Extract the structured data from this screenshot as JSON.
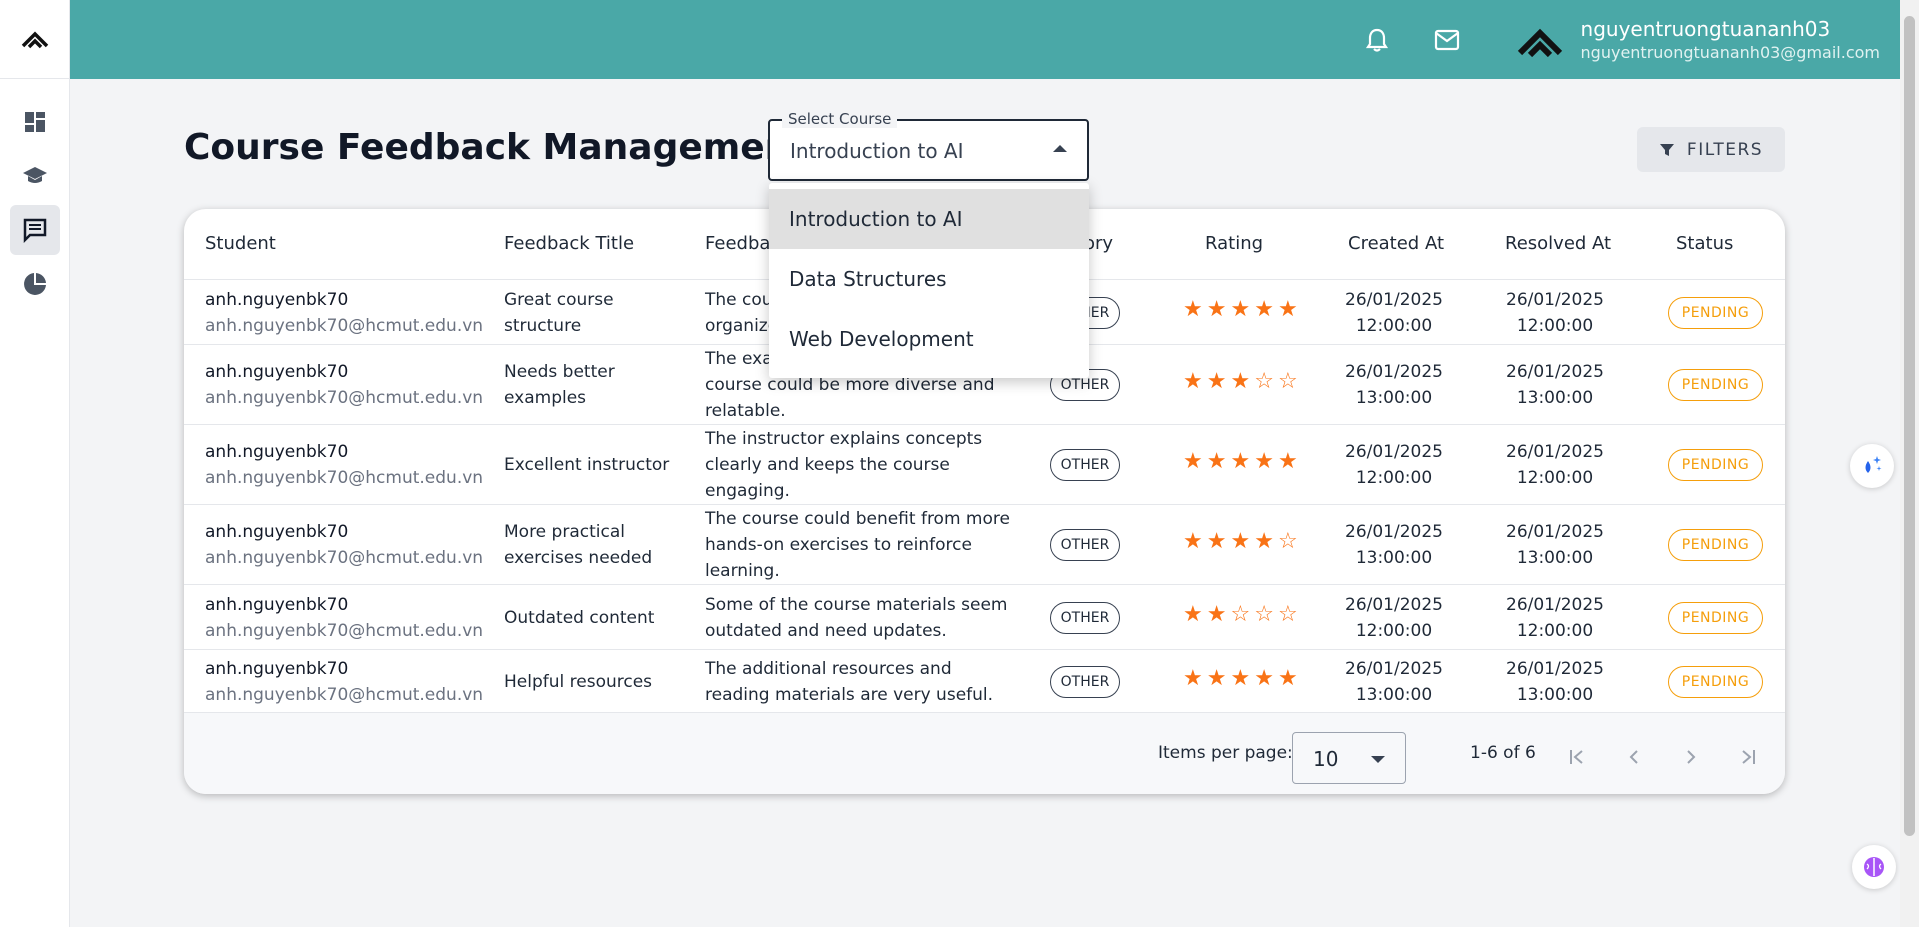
{
  "topbar": {
    "user_name": "nguyentruongtuananh03",
    "user_email": "nguyentruongtuananh03@gmail.com"
  },
  "page": {
    "title": "Course Feedback Management",
    "select_label": "Select Course",
    "selected_course": "Introduction to AI",
    "filters_label": "FILTERS"
  },
  "dropdown": {
    "options": [
      "Introduction to AI",
      "Data Structures",
      "Web Development"
    ]
  },
  "table": {
    "headers": {
      "student": "Student",
      "title": "Feedback Title",
      "content": "Feedback",
      "category": "ory",
      "rating": "Rating",
      "created": "Created At",
      "resolved": "Resolved At",
      "status": "Status"
    },
    "rows": [
      {
        "name": "anh.nguyenbk70",
        "email": "anh.nguyenbk70@hcmut.edu.vn",
        "title1": "Great course",
        "title2": "structure",
        "c1": "The course",
        "c2": "organized",
        "c3": "",
        "category": "OTHER",
        "rating": 5,
        "cd": "26/01/2025",
        "ct": "12:00:00",
        "rd": "26/01/2025",
        "rt": "12:00:00",
        "status": "PENDING"
      },
      {
        "name": "anh.nguyenbk70",
        "email": "anh.nguyenbk70@hcmut.edu.vn",
        "title1": "Needs better",
        "title2": "examples",
        "c1": "The examples",
        "c2": "course could be more diverse and",
        "c3": "relatable.",
        "category": "OTHER",
        "rating": 3,
        "cd": "26/01/2025",
        "ct": "13:00:00",
        "rd": "26/01/2025",
        "rt": "13:00:00",
        "status": "PENDING"
      },
      {
        "name": "anh.nguyenbk70",
        "email": "anh.nguyenbk70@hcmut.edu.vn",
        "title1": "Excellent instructor",
        "title2": "",
        "c1": "The instructor explains concepts",
        "c2": "clearly and keeps the course",
        "c3": "engaging.",
        "category": "OTHER",
        "rating": 5,
        "cd": "26/01/2025",
        "ct": "12:00:00",
        "rd": "26/01/2025",
        "rt": "12:00:00",
        "status": "PENDING"
      },
      {
        "name": "anh.nguyenbk70",
        "email": "anh.nguyenbk70@hcmut.edu.vn",
        "title1": "More practical",
        "title2": "exercises needed",
        "c1": "The course could benefit from more",
        "c2": "hands-on exercises to reinforce",
        "c3": "learning.",
        "category": "OTHER",
        "rating": 4,
        "cd": "26/01/2025",
        "ct": "13:00:00",
        "rd": "26/01/2025",
        "rt": "13:00:00",
        "status": "PENDING"
      },
      {
        "name": "anh.nguyenbk70",
        "email": "anh.nguyenbk70@hcmut.edu.vn",
        "title1": "Outdated content",
        "title2": "",
        "c1": "Some of the course materials seem",
        "c2": "outdated and need updates.",
        "c3": "",
        "category": "OTHER",
        "rating": 2,
        "cd": "26/01/2025",
        "ct": "12:00:00",
        "rd": "26/01/2025",
        "rt": "12:00:00",
        "status": "PENDING"
      },
      {
        "name": "anh.nguyenbk70",
        "email": "anh.nguyenbk70@hcmut.edu.vn",
        "title1": "Helpful resources",
        "title2": "",
        "c1": "The additional resources and",
        "c2": "reading materials are very useful.",
        "c3": "",
        "category": "OTHER",
        "rating": 5,
        "cd": "26/01/2025",
        "ct": "13:00:00",
        "rd": "26/01/2025",
        "rt": "13:00:00",
        "status": "PENDING"
      }
    ]
  },
  "pagination": {
    "items_per_page_label": "Items per page:",
    "items_per_page": "10",
    "range": "1-6 of 6"
  },
  "icons": {
    "logo": "logo-icon",
    "nav": [
      "dashboard-icon",
      "school-icon",
      "chat-icon",
      "pie-chart-icon"
    ],
    "bell": "bell-icon",
    "mail": "mail-icon"
  },
  "colors": {
    "topbar": "#4aa8a7",
    "star": "#f97316",
    "pending": "#f59e0b"
  }
}
